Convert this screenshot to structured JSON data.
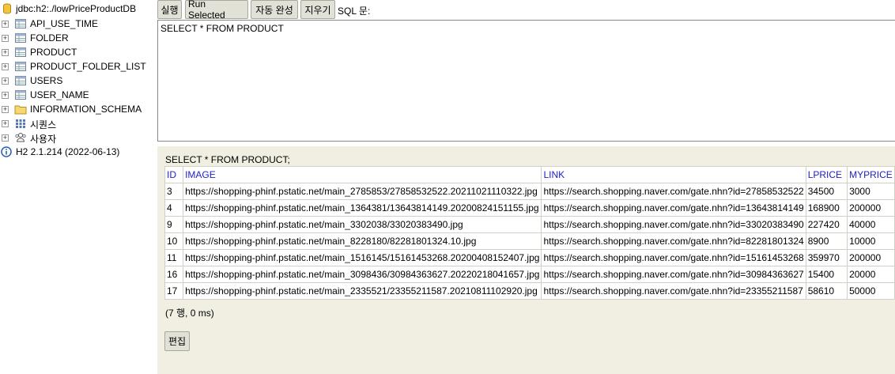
{
  "tree": {
    "root": "jdbc:h2:./lowPriceProductDB",
    "tables": [
      "API_USE_TIME",
      "FOLDER",
      "PRODUCT",
      "PRODUCT_FOLDER_LIST",
      "USERS",
      "USER_NAME"
    ],
    "schema": "INFORMATION_SCHEMA",
    "sequences": "시퀀스",
    "users": "사용자",
    "version": "H2 2.1.214 (2022-06-13)",
    "expander_symbol": "+"
  },
  "toolbar": {
    "run": "실행",
    "run_selected": "Run Selected",
    "autocomplete": "자동 완성",
    "clear": "지우기",
    "sql_label": "SQL 문:"
  },
  "editor": {
    "text": "SELECT * FROM PRODUCT"
  },
  "result": {
    "sql": "SELECT * FROM PRODUCT;",
    "columns": [
      "ID",
      "IMAGE",
      "LINK",
      "LPRICE",
      "MYPRICE"
    ],
    "rows": [
      [
        "3",
        "https://shopping-phinf.pstatic.net/main_2785853/27858532522.20211021110322.jpg",
        "https://search.shopping.naver.com/gate.nhn?id=27858532522",
        "34500",
        "3000"
      ],
      [
        "4",
        "https://shopping-phinf.pstatic.net/main_1364381/13643814149.20200824151155.jpg",
        "https://search.shopping.naver.com/gate.nhn?id=13643814149",
        "168900",
        "200000"
      ],
      [
        "9",
        "https://shopping-phinf.pstatic.net/main_3302038/33020383490.jpg",
        "https://search.shopping.naver.com/gate.nhn?id=33020383490",
        "227420",
        "40000"
      ],
      [
        "10",
        "https://shopping-phinf.pstatic.net/main_8228180/82281801324.10.jpg",
        "https://search.shopping.naver.com/gate.nhn?id=82281801324",
        "8900",
        "10000"
      ],
      [
        "11",
        "https://shopping-phinf.pstatic.net/main_1516145/15161453268.20200408152407.jpg",
        "https://search.shopping.naver.com/gate.nhn?id=15161453268",
        "359970",
        "200000"
      ],
      [
        "16",
        "https://shopping-phinf.pstatic.net/main_3098436/30984363627.20220218041657.jpg",
        "https://search.shopping.naver.com/gate.nhn?id=30984363627",
        "15400",
        "20000"
      ],
      [
        "17",
        "https://shopping-phinf.pstatic.net/main_2335521/23355211587.20210811102920.jpg",
        "https://search.shopping.naver.com/gate.nhn?id=23355211587",
        "58610",
        "50000"
      ]
    ],
    "count": "(7 행, 0 ms)",
    "edit": "편집"
  }
}
